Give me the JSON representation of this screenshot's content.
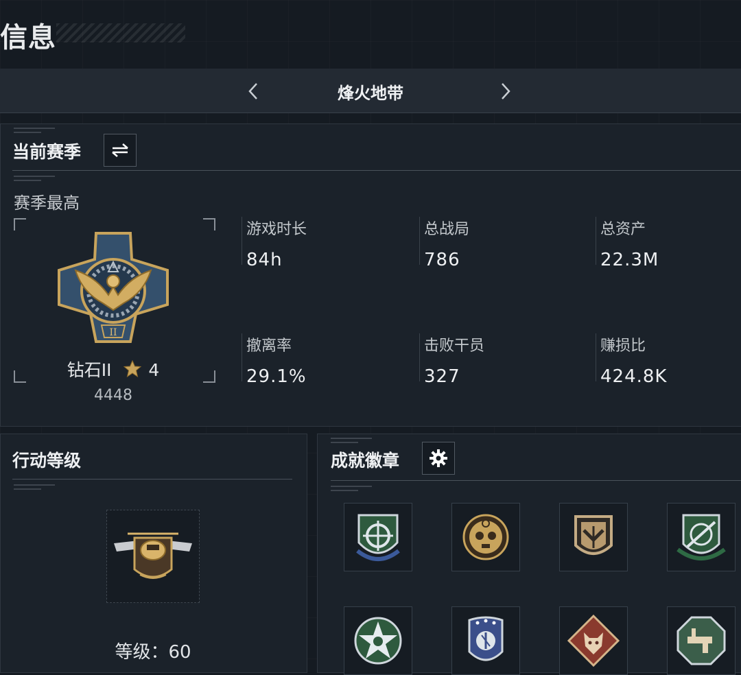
{
  "page": {
    "title": "信息"
  },
  "mode_selector": {
    "title": "烽火地带",
    "prev_icon": "chevron-left-icon",
    "next_icon": "chevron-right-icon"
  },
  "current_season": {
    "title": "当前赛季",
    "switch_icon": "swap-arrows-icon",
    "season_high_label": "赛季最高",
    "rank": {
      "name": "钻石II",
      "stars": "4",
      "star_icon": "star-icon",
      "score": "4448",
      "medal_icon": "diamond-eagle-medal-icon"
    },
    "stats": [
      {
        "label": "游戏时长",
        "value": "84h"
      },
      {
        "label": "总战局",
        "value": "786"
      },
      {
        "label": "总资产",
        "value": "22.3M"
      },
      {
        "label": "撤离率",
        "value": "29.1%"
      },
      {
        "label": "击败干员",
        "value": "327"
      },
      {
        "label": "赚损比",
        "value": "424.8K"
      }
    ]
  },
  "action_level": {
    "title": "行动等级",
    "level_label": "等级：",
    "level_value": "60",
    "emblem_icon": "helicopter-emblem-icon"
  },
  "achievements": {
    "title": "成就徽章",
    "settings_icon": "gear-icon",
    "badges": [
      {
        "icon": "green-crosshair-shield-badge-icon"
      },
      {
        "icon": "gold-skull-medallion-badge-icon"
      },
      {
        "icon": "bronze-chevron-shield-badge-icon"
      },
      {
        "icon": "green-rifle-shield-badge-icon"
      },
      {
        "icon": "green-star-wreath-badge-icon"
      },
      {
        "icon": "blue-stars-shield-badge-icon"
      },
      {
        "icon": "red-wolf-diamond-badge-icon"
      },
      {
        "icon": "green-gun-octagon-badge-icon"
      }
    ]
  },
  "colors": {
    "background": "#151b22",
    "panel": "#1b222a",
    "gold": "#c8a45c",
    "steel_blue": "#3b5a78"
  }
}
